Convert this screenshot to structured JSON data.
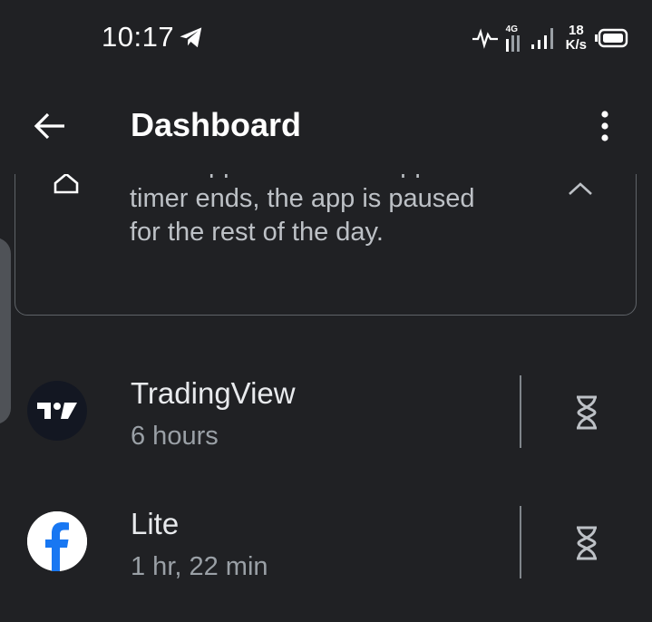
{
  "status_bar": {
    "time": "10:17",
    "lte": "4G",
    "speed_value": "18",
    "speed_unit": "K/s"
  },
  "app_bar": {
    "title": "Dashboard"
  },
  "info_card": {
    "text": "most apps. When the app timer ends, the app is paused for the rest of the day."
  },
  "apps": [
    {
      "name": "TradingView",
      "usage": "6 hours",
      "icon": "tradingview-logo"
    },
    {
      "name": "Lite",
      "usage": "1 hr, 22 min",
      "icon": "facebook-logo"
    }
  ],
  "colors": {
    "background": "#202124",
    "facebook_blue": "#1877f2",
    "tradingview_bg": "#131722"
  }
}
